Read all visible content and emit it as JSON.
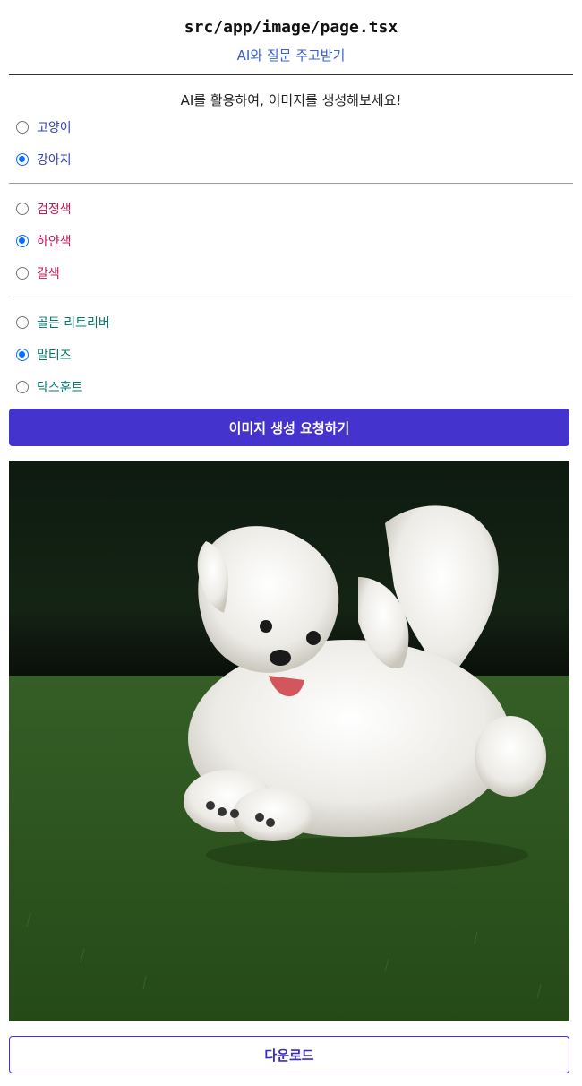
{
  "header": {
    "title": "src/app/image/page.tsx",
    "link_label": "AI와 질문 주고받기"
  },
  "main": {
    "subtitle": "AI를 활용하여, 이미지를 생성해보세요!",
    "animal_options": [
      {
        "label": "고양이",
        "checked": false
      },
      {
        "label": "강아지",
        "checked": true
      }
    ],
    "color_options": [
      {
        "label": "검정색",
        "checked": false
      },
      {
        "label": "하얀색",
        "checked": true
      },
      {
        "label": "갈색",
        "checked": false
      }
    ],
    "breed_options": [
      {
        "label": "골든 리트리버",
        "checked": false
      },
      {
        "label": "말티즈",
        "checked": true
      },
      {
        "label": "닥스훈트",
        "checked": false
      }
    ],
    "generate_button_label": "이미지 생성 요청하기",
    "download_button_label": "다운로드"
  },
  "colors": {
    "primary": "#4433cc",
    "radio_checked": "#0b6cff",
    "animal_text": "#3340b8",
    "color_text": "#c2185b",
    "breed_text": "#00796b"
  }
}
